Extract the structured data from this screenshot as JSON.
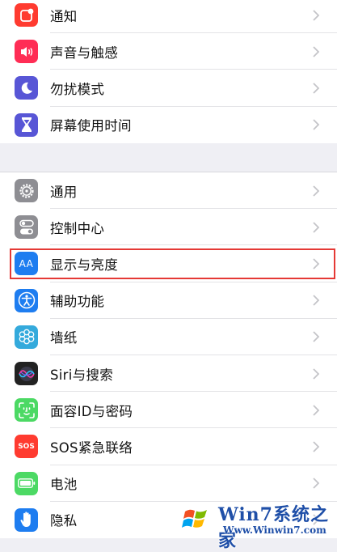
{
  "groups": [
    {
      "items": [
        {
          "label": "通知",
          "icon": "notifications-icon",
          "color": "#ff3b30"
        },
        {
          "label": "声音与触感",
          "icon": "sound-icon",
          "color": "#ff2d55"
        },
        {
          "label": "勿扰模式",
          "icon": "moon-icon",
          "color": "#5856d6"
        },
        {
          "label": "屏幕使用时间",
          "icon": "hourglass-icon",
          "color": "#5856d6"
        }
      ]
    },
    {
      "items": [
        {
          "label": "通用",
          "icon": "gear-icon",
          "color": "#8e8e93"
        },
        {
          "label": "控制中心",
          "icon": "toggles-icon",
          "color": "#8e8e93"
        },
        {
          "label": "显示与亮度",
          "icon": "text-size-icon",
          "color": "#1e7df0"
        },
        {
          "label": "辅助功能",
          "icon": "accessibility-icon",
          "color": "#1e7df0"
        },
        {
          "label": "墙纸",
          "icon": "flower-icon",
          "color": "#34aadc"
        },
        {
          "label": "Siri与搜索",
          "icon": "siri-icon",
          "color": "#222222"
        },
        {
          "label": "面容ID与密码",
          "icon": "face-id-icon",
          "color": "#4cd964"
        },
        {
          "label": "SOS紧急联络",
          "icon": "sos-icon",
          "color": "#ff3b30"
        },
        {
          "label": "电池",
          "icon": "battery-icon",
          "color": "#4cd964"
        },
        {
          "label": "隐私",
          "icon": "hand-icon",
          "color": "#1e7df0"
        }
      ]
    }
  ],
  "icon_text": {
    "text_size": "AA",
    "sos": "SOS"
  },
  "highlighted_item": "显示与亮度",
  "watermark": {
    "title": "Win7系统之家",
    "url": "Www.Winwin7.com"
  }
}
